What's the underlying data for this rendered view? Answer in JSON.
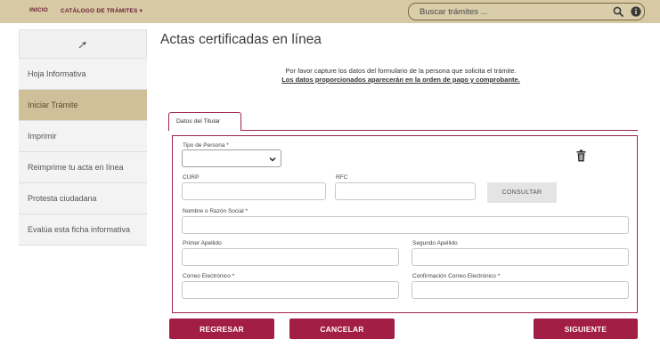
{
  "nav": {
    "home": "INICIO",
    "catalog": "CATÁLOGO DE TRÁMITES ▾"
  },
  "search": {
    "placeholder": "Buscar trámites ...",
    "search_icon": "magnifier-icon",
    "info_icon": "info-icon"
  },
  "sidebar": {
    "pin_icon": "pin-icon",
    "items": [
      {
        "label": "Hoja Informativa",
        "active": false
      },
      {
        "label": "Iniciar Trámite",
        "active": true
      },
      {
        "label": "Imprimir",
        "active": false
      },
      {
        "label": "Reimprime tu acta en línea",
        "active": false
      },
      {
        "label": "Protesta ciudadana",
        "active": false
      },
      {
        "label": "Evalúa esta ficha informativa",
        "active": false
      }
    ]
  },
  "main": {
    "title": "Actas certificadas en línea",
    "intro_line1": "Por favor capture los datos del formulario de la persona que solicita el trámite.",
    "intro_line2": "Los datos proporcionados aparecerán en la orden de pago y comprobante."
  },
  "form": {
    "tab_label": "Datos del Titular",
    "tipo_persona_label": "Tipo de Persona *",
    "tipo_persona_value": "",
    "curp_label": "CURP",
    "rfc_label": "RFC",
    "consultar_label": "CONSULTAR",
    "nombre_label": "Nombre o Razón Social *",
    "primer_apellido_label": "Primer Apellido",
    "segundo_apellido_label": "Segundo Apellido",
    "correo_label": "Correo Electrónico *",
    "confirm_correo_label": "Confirmación Correo Electrónico *"
  },
  "actions": {
    "back": "REGRESAR",
    "cancel": "CANCELAR",
    "next": "SIGUIENTE"
  },
  "colors": {
    "topbar": "#d6c9a4",
    "accent": "#a31e44",
    "active_sidebar": "#cfc09a"
  }
}
